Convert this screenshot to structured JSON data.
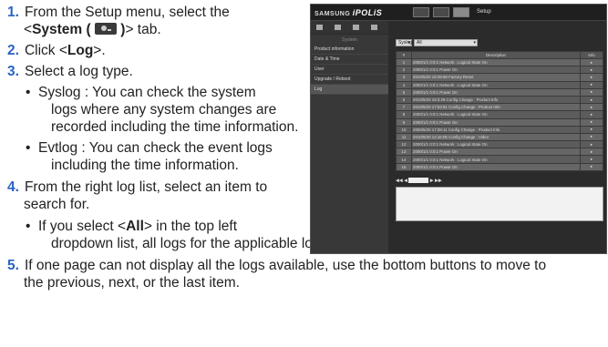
{
  "steps": [
    {
      "num": "1.",
      "a": "From the Setup menu, select the",
      "b_pre": "<",
      "b_bold": "System ( ",
      "b_mid": " )",
      "b_post": "> tab."
    },
    {
      "num": "2.",
      "pre": "Click <",
      "bold": "Log",
      "post": ">."
    },
    {
      "num": "3.",
      "text": "Select a log type."
    },
    {
      "num": "4.",
      "a": "From the right log list, select an item to",
      "b": "search for."
    },
    {
      "num": "5.",
      "a": "If one page can not display all the logs available, use the bottom buttons to move to",
      "b": "the previous, next, or the last item."
    }
  ],
  "bullets": {
    "syslog": [
      "Syslog : You can check the system",
      "logs where any system changes are",
      "recorded including the time information."
    ],
    "evtlog": [
      "Evtlog : You can check the event logs",
      "including the time information."
    ],
    "all_pre": "If you select <",
    "all_bold": "All",
    "all_post": "> in the top left",
    "all_line2": "dropdown list, all logs for the applicable log type will be displayed."
  },
  "screenshot": {
    "brand_prefix": "SAMSUNG",
    "brand_name": "iPOLiS",
    "setup_label": "Setup",
    "sidebar_title": "System",
    "sidebar_items": [
      "Product information",
      "Date & Time",
      "User",
      "Upgrade / Reboot",
      "Log"
    ],
    "log_type": "Syslog",
    "filter": "All",
    "columns": [
      "#",
      "Description",
      "Info"
    ],
    "rows": [
      {
        "n": "1",
        "d": "2000/1/1 0:0:1 Network : Logical State On",
        "i": "▸"
      },
      {
        "n": "2",
        "d": "2000/1/1 0:0:1 Power On",
        "i": "▸"
      },
      {
        "n": "3",
        "d": "2010/5/20 16:29:58 Factory Reset",
        "i": "▸"
      },
      {
        "n": "4",
        "d": "2000/1/1 0:0:1 Network : Logical State On",
        "i": "▸"
      },
      {
        "n": "5",
        "d": "2000/1/1 0:0:1 Power On",
        "i": "▸"
      },
      {
        "n": "6",
        "d": "2010/5/20 18:3:29 Config Change : Product Info",
        "i": "▸"
      },
      {
        "n": "7",
        "d": "2010/5/20 17:53:51 Config Change : Product Info",
        "i": "▸"
      },
      {
        "n": "8",
        "d": "2000/1/1 0:0:1 Network : Logical State On",
        "i": "▸"
      },
      {
        "n": "9",
        "d": "2000/1/1 0:0:1 Power On",
        "i": "▸"
      },
      {
        "n": "10",
        "d": "2000/5/20 17:29:11 Config Change : Product Info",
        "i": "▸"
      },
      {
        "n": "11",
        "d": "2010/5/20 14:16:05 Config Change : Video",
        "i": "▸"
      },
      {
        "n": "12",
        "d": "2000/1/1 0:0:1 Network : Logical State On",
        "i": "▸"
      },
      {
        "n": "13",
        "d": "2000/1/1 0:0:1 Power On",
        "i": "▸"
      },
      {
        "n": "14",
        "d": "2000/1/1 0:0:1 Network : Logical State On",
        "i": "▸"
      },
      {
        "n": "15",
        "d": "2000/1/1 0:0:1 Power On",
        "i": "▸"
      }
    ],
    "pager": {
      "first": "◀◀",
      "prev": "◀",
      "next": "▶",
      "last": "▶▶"
    }
  },
  "colors": {
    "step_number": "#2a63c4",
    "panel_bg": "#2b2b2b"
  }
}
